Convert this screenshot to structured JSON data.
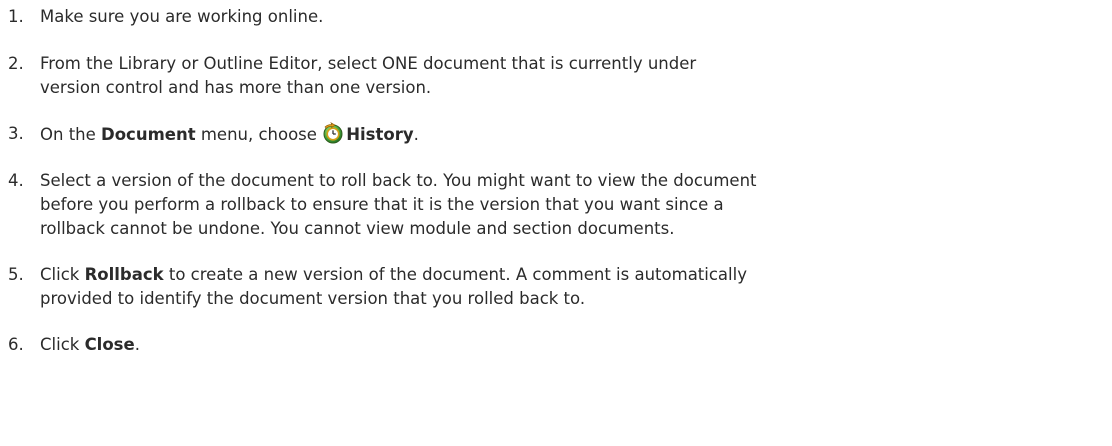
{
  "steps": [
    {
      "num": "1.",
      "lines": [
        "Make sure you are working online."
      ]
    },
    {
      "num": "2.",
      "lines": [
        "From the Library or Outline Editor, select ONE document that is currently under",
        "version control and has more than one version."
      ]
    },
    {
      "num": "3.",
      "pre": "On the ",
      "bold1": "Document",
      "mid": " menu, choose ",
      "bold2": "History",
      "post": "."
    },
    {
      "num": "4.",
      "lines": [
        "Select a version of the document to roll back to. You might want to view the document",
        "before you perform a rollback to ensure that it is the version that you want since a",
        "rollback cannot be undone. You cannot view module and section documents."
      ]
    },
    {
      "num": "5.",
      "pre": "Click ",
      "bold1": "Rollback",
      "post": " to create a new version of the document. A comment is automatically",
      "line2": "provided to identify the document version that you rolled back to."
    },
    {
      "num": "6.",
      "pre": "Click ",
      "bold1": "Close",
      "post": "."
    }
  ],
  "icons": {
    "history": "history-clock-icon"
  },
  "colors": {
    "text": "#2b2b2b",
    "background": "#ffffff"
  }
}
